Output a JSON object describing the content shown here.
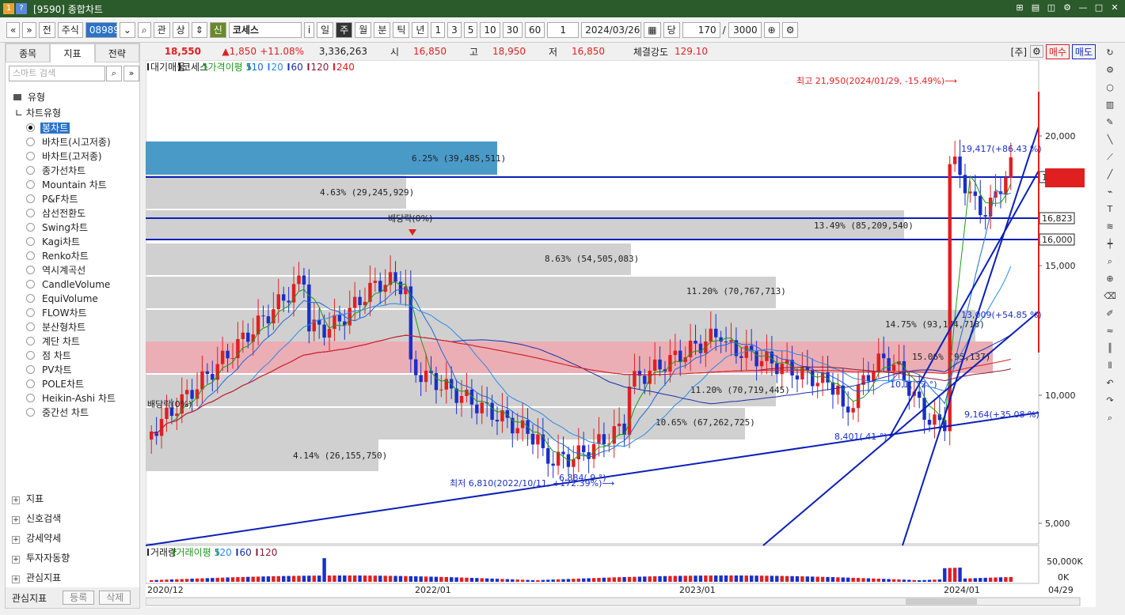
{
  "window": {
    "title": "[9590] 종합차트",
    "icon_a": "1",
    "icon_b": "?"
  },
  "toolbar": {
    "nav_prev": "«",
    "nav_dropdown": "»",
    "prev_label": "전",
    "market": "주식",
    "code": "089890",
    "lookup": "관",
    "compare": "상",
    "badge": "신",
    "stock_name": "코세스",
    "info": "i",
    "periods": [
      "일",
      "주",
      "월",
      "분",
      "틱",
      "년"
    ],
    "active_period": "주",
    "intervals": [
      "1",
      "3",
      "5",
      "10",
      "30",
      "60"
    ],
    "interval_value": "1",
    "date": "2024/03/26",
    "count_label": "당",
    "count": "170",
    "max": "3000"
  },
  "left_panel": {
    "tabs": [
      "종목",
      "지표",
      "전략"
    ],
    "active_tab": "지표",
    "search_placeholder": "스마트 검색",
    "type_header": "유형",
    "chart_type_header": "차트유형",
    "items": [
      "봉차트",
      "바차트(시고저종)",
      "바차트(고저종)",
      "종가선차트",
      "Mountain 차트",
      "P&F차트",
      "삼선전환도",
      "Swing차트",
      "Kagi차트",
      "Renko차트",
      "역시계곡선",
      "CandleVolume",
      "EquiVolume",
      "FLOW차트",
      "분산형차트",
      "계단 차트",
      "점 차트",
      "PV차트",
      "POLE차트",
      "Heikin-Ashi 차트",
      "중간선 차트"
    ],
    "selected": "봉차트",
    "groups": [
      "지표",
      "신호검색",
      "강세약세",
      "투자자동향",
      "관심지표"
    ],
    "fav_label": "관심지표",
    "fav_register": "등록",
    "fav_delete": "삭제"
  },
  "price_bar": {
    "last": "18,550",
    "change": "▲1,850",
    "change_pct": "+11.08%",
    "volume": "3,336,263",
    "open_label": "시",
    "open": "16,850",
    "high_label": "고",
    "high": "18,950",
    "low_label": "저",
    "low": "16,850",
    "strength_label": "체결강도",
    "strength": "129.10",
    "unit": "[주]",
    "buy": "매수",
    "sell": "매도"
  },
  "chart_header": {
    "items": [
      "대기매물",
      "코세스",
      "가격이평 5",
      "10",
      "20",
      "60",
      "120",
      "240"
    ]
  },
  "volume_header": {
    "items": [
      "거래량",
      "거래이평 5",
      "20",
      "60",
      "120"
    ]
  },
  "colors": {
    "up": "#e02020",
    "down": "#1a2fc8",
    "band_pink": "#e8a0a8",
    "band_blue": "#4a9ac8",
    "band_gray": "#d0d0d0",
    "line_blue": "#0a1fb8",
    "ma5": "#1a9a1a",
    "ma10": "#1a6ad8",
    "ma20": "#2a8ae8",
    "ma60": "#1a2fa8",
    "ma120": "#8a1a3a",
    "ma240": "#e02020"
  },
  "chart_data": {
    "type": "candlestick",
    "y_ticks": [
      "20,000",
      "15,000",
      "10,000",
      "5,000"
    ],
    "x_ticks": [
      "2020/12",
      "2022/01",
      "2023/01",
      "2024/01",
      "04/29"
    ],
    "volume_ticks": [
      "50,000K",
      "0K"
    ],
    "price_tags": [
      "18,450",
      "16,823",
      "16,000"
    ],
    "volume_profile": [
      {
        "label": "6.25% (39,485,511)",
        "pct": 6.25
      },
      {
        "label": "4.63% (29,245,929)",
        "pct": 4.63
      },
      {
        "label": "13.49% (85,209,540)",
        "pct": 13.49
      },
      {
        "label": "8.63% (54,505,083)",
        "pct": 8.63
      },
      {
        "label": "11.20% (70,767,713)",
        "pct": 11.2
      },
      {
        "label": "14.75% (93,174,718)",
        "pct": 14.75
      },
      {
        "label": "15.06% (95,137)",
        "pct": 15.06
      },
      {
        "label": "11.20% (70,719,445)",
        "pct": 11.2
      },
      {
        "label": "10.65% (67,262,725)",
        "pct": 10.65
      },
      {
        "label": "4.14% (26,155,750)",
        "pct": 4.14
      }
    ],
    "annotations": {
      "max": "최고 21,950(2024/01/29, -15.49%)⟶",
      "min": "최저 6,810(2022/10/11, +172.39%)⟶",
      "div1": "배당락(0%)",
      "div2": "배당락(0%)",
      "fib1": "19,417(+86.43 %)",
      "fib2": "13,009(+54.85 %)",
      "fib3": "9,164(+35.08 %)",
      "fib4": "8,401( 41 °)",
      "fib5": "6,884( 9 °)",
      "fib6": "10,1( 72 °)"
    }
  }
}
